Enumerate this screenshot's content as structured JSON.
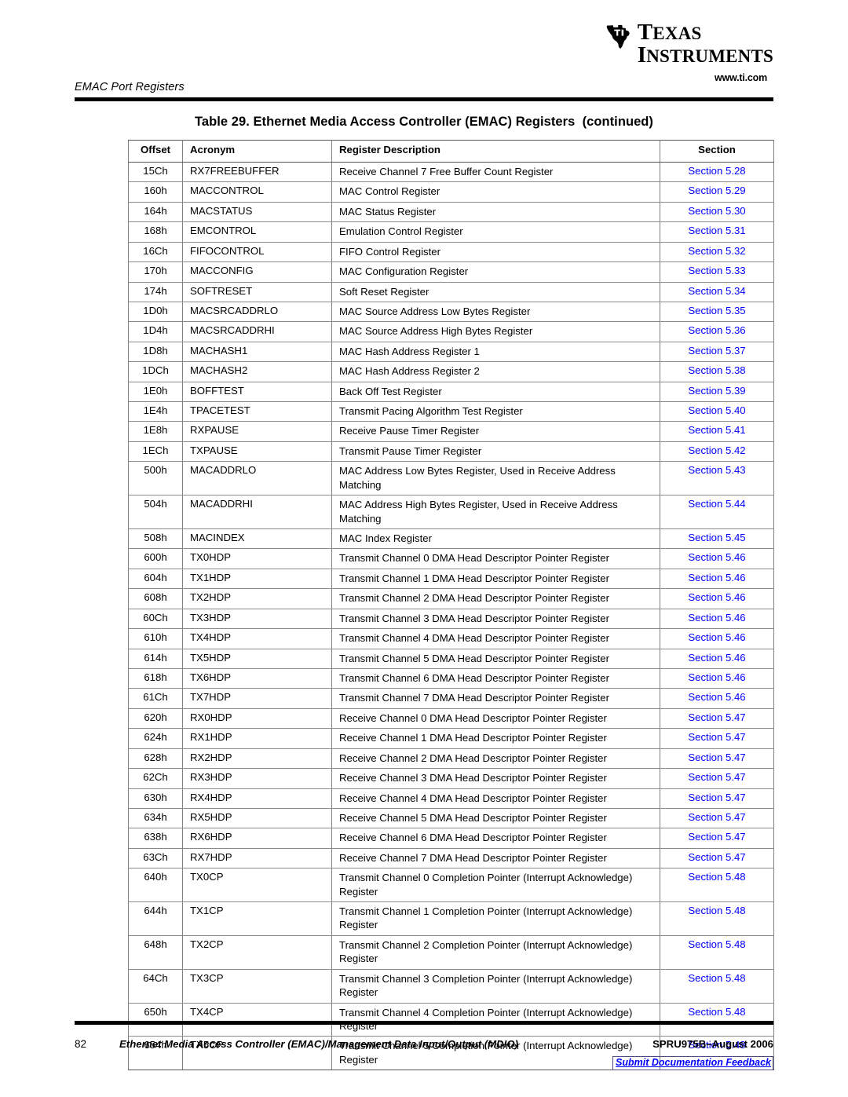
{
  "brand": {
    "logo_line1": "Texas",
    "logo_line2": "Instruments",
    "url": "www.ti.com",
    "logo_icon": "texas-state-outline-ti-mark"
  },
  "header": {
    "running_head": "EMAC Port Registers"
  },
  "table": {
    "title": "Table 29. Ethernet Media Access Controller (EMAC) Registers  (continued)",
    "columns": [
      "Offset",
      "Acronym",
      "Register Description",
      "Section"
    ],
    "rows": [
      {
        "offset": "15Ch",
        "acronym": "RX7FREEBUFFER",
        "description": "Receive Channel 7 Free Buffer Count Register",
        "section": "Section 5.28"
      },
      {
        "offset": "160h",
        "acronym": "MACCONTROL",
        "description": "MAC Control Register",
        "section": "Section 5.29"
      },
      {
        "offset": "164h",
        "acronym": "MACSTATUS",
        "description": "MAC Status Register",
        "section": "Section 5.30"
      },
      {
        "offset": "168h",
        "acronym": "EMCONTROL",
        "description": "Emulation Control Register",
        "section": "Section 5.31"
      },
      {
        "offset": "16Ch",
        "acronym": "FIFOCONTROL",
        "description": "FIFO Control Register",
        "section": "Section 5.32"
      },
      {
        "offset": "170h",
        "acronym": "MACCONFIG",
        "description": "MAC Configuration Register",
        "section": "Section 5.33"
      },
      {
        "offset": "174h",
        "acronym": "SOFTRESET",
        "description": "Soft Reset Register",
        "section": "Section 5.34"
      },
      {
        "offset": "1D0h",
        "acronym": "MACSRCADDRLO",
        "description": "MAC Source Address Low Bytes Register",
        "section": "Section 5.35"
      },
      {
        "offset": "1D4h",
        "acronym": "MACSRCADDRHI",
        "description": "MAC Source Address High Bytes Register",
        "section": "Section 5.36"
      },
      {
        "offset": "1D8h",
        "acronym": "MACHASH1",
        "description": "MAC Hash Address Register 1",
        "section": "Section 5.37"
      },
      {
        "offset": "1DCh",
        "acronym": "MACHASH2",
        "description": "MAC Hash Address Register 2",
        "section": "Section 5.38"
      },
      {
        "offset": "1E0h",
        "acronym": "BOFFTEST",
        "description": "Back Off Test Register",
        "section": "Section 5.39"
      },
      {
        "offset": "1E4h",
        "acronym": "TPACETEST",
        "description": "Transmit Pacing Algorithm Test Register",
        "section": "Section 5.40"
      },
      {
        "offset": "1E8h",
        "acronym": "RXPAUSE",
        "description": "Receive Pause Timer Register",
        "section": "Section 5.41"
      },
      {
        "offset": "1ECh",
        "acronym": "TXPAUSE",
        "description": "Transmit Pause Timer Register",
        "section": "Section 5.42"
      },
      {
        "offset": "500h",
        "acronym": "MACADDRLO",
        "description": "MAC Address Low Bytes Register, Used in Receive Address Matching",
        "section": "Section 5.43",
        "two_line": true
      },
      {
        "offset": "504h",
        "acronym": "MACADDRHI",
        "description": "MAC Address High Bytes Register, Used in Receive Address Matching",
        "section": "Section 5.44",
        "two_line": true
      },
      {
        "offset": "508h",
        "acronym": "MACINDEX",
        "description": "MAC Index Register",
        "section": "Section 5.45"
      },
      {
        "offset": "600h",
        "acronym": "TX0HDP",
        "description": "Transmit Channel 0 DMA Head Descriptor Pointer Register",
        "section": "Section 5.46"
      },
      {
        "offset": "604h",
        "acronym": "TX1HDP",
        "description": "Transmit Channel 1 DMA Head Descriptor Pointer Register",
        "section": "Section 5.46"
      },
      {
        "offset": "608h",
        "acronym": "TX2HDP",
        "description": "Transmit Channel 2 DMA Head Descriptor Pointer Register",
        "section": "Section 5.46"
      },
      {
        "offset": "60Ch",
        "acronym": "TX3HDP",
        "description": "Transmit Channel 3 DMA Head Descriptor Pointer Register",
        "section": "Section 5.46"
      },
      {
        "offset": "610h",
        "acronym": "TX4HDP",
        "description": "Transmit Channel 4 DMA Head Descriptor Pointer Register",
        "section": "Section 5.46"
      },
      {
        "offset": "614h",
        "acronym": "TX5HDP",
        "description": "Transmit Channel 5 DMA Head Descriptor Pointer Register",
        "section": "Section 5.46"
      },
      {
        "offset": "618h",
        "acronym": "TX6HDP",
        "description": "Transmit Channel 6 DMA Head Descriptor Pointer Register",
        "section": "Section 5.46"
      },
      {
        "offset": "61Ch",
        "acronym": "TX7HDP",
        "description": "Transmit Channel 7 DMA Head Descriptor Pointer Register",
        "section": "Section 5.46"
      },
      {
        "offset": "620h",
        "acronym": "RX0HDP",
        "description": "Receive Channel 0 DMA Head Descriptor Pointer Register",
        "section": "Section 5.47"
      },
      {
        "offset": "624h",
        "acronym": "RX1HDP",
        "description": "Receive Channel 1 DMA Head Descriptor Pointer Register",
        "section": "Section 5.47"
      },
      {
        "offset": "628h",
        "acronym": "RX2HDP",
        "description": "Receive Channel 2 DMA Head Descriptor Pointer Register",
        "section": "Section 5.47"
      },
      {
        "offset": "62Ch",
        "acronym": "RX3HDP",
        "description": "Receive Channel 3 DMA Head Descriptor Pointer Register",
        "section": "Section 5.47"
      },
      {
        "offset": "630h",
        "acronym": "RX4HDP",
        "description": "Receive Channel 4 DMA Head Descriptor Pointer Register",
        "section": "Section 5.47"
      },
      {
        "offset": "634h",
        "acronym": "RX5HDP",
        "description": "Receive Channel 5 DMA Head Descriptor Pointer Register",
        "section": "Section 5.47"
      },
      {
        "offset": "638h",
        "acronym": "RX6HDP",
        "description": "Receive Channel 6 DMA Head Descriptor Pointer Register",
        "section": "Section 5.47"
      },
      {
        "offset": "63Ch",
        "acronym": "RX7HDP",
        "description": "Receive Channel 7 DMA Head Descriptor Pointer Register",
        "section": "Section 5.47"
      },
      {
        "offset": "640h",
        "acronym": "TX0CP",
        "description": "Transmit Channel 0 Completion Pointer (Interrupt Acknowledge) Register",
        "section": "Section 5.48",
        "two_line": true
      },
      {
        "offset": "644h",
        "acronym": "TX1CP",
        "description": "Transmit Channel 1 Completion Pointer (Interrupt Acknowledge) Register",
        "section": "Section 5.48",
        "two_line": true
      },
      {
        "offset": "648h",
        "acronym": "TX2CP",
        "description": "Transmit Channel 2 Completion Pointer (Interrupt Acknowledge) Register",
        "section": "Section 5.48",
        "two_line": true
      },
      {
        "offset": "64Ch",
        "acronym": "TX3CP",
        "description": "Transmit Channel 3 Completion Pointer (Interrupt Acknowledge) Register",
        "section": "Section 5.48",
        "two_line": true
      },
      {
        "offset": "650h",
        "acronym": "TX4CP",
        "description": "Transmit Channel 4 Completion Pointer (Interrupt Acknowledge) Register",
        "section": "Section 5.48",
        "two_line": true
      },
      {
        "offset": "654h",
        "acronym": "TX5CP",
        "description": "Transmit Channel 5 Completion Pointer (Interrupt Acknowledge) Register",
        "section": "Section 5.48",
        "two_line": true
      }
    ]
  },
  "footer": {
    "page_number": "82",
    "document_title": "Ethernet Media Access Controller (EMAC)/Management Data Input/Output (MDIO)",
    "doc_id": "SPRU975B–August 2006",
    "feedback_link": "Submit Documentation Feedback"
  },
  "colors": {
    "link_blue": "#0000ff",
    "rule_black": "#000000",
    "grid_gray": "#808080"
  }
}
